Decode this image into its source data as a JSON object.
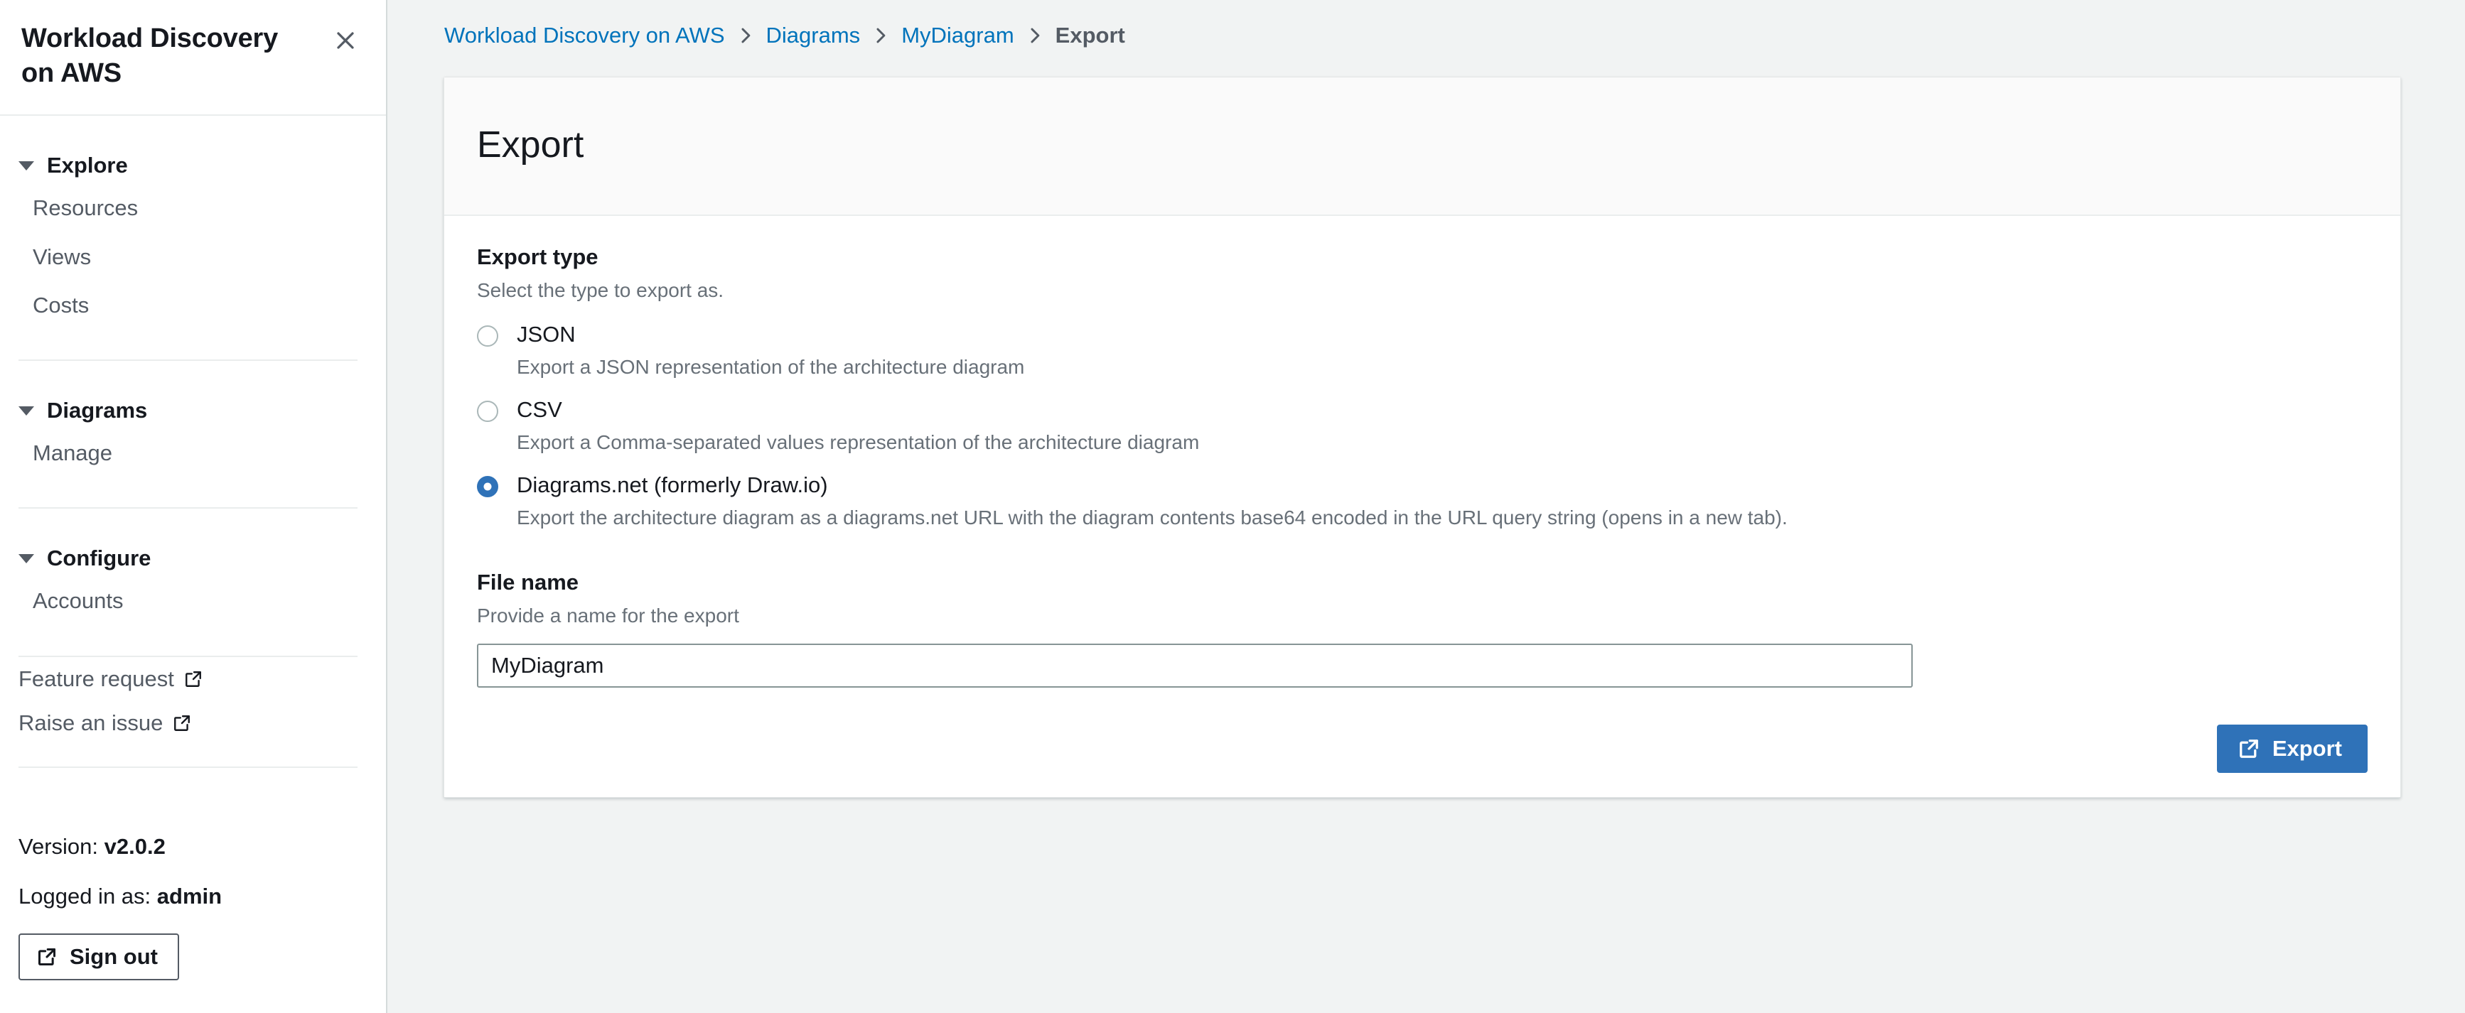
{
  "sidebar": {
    "title": "Workload Discovery on AWS",
    "close_icon": "close-icon",
    "groups": [
      {
        "label": "Explore",
        "items": [
          {
            "label": "Resources"
          },
          {
            "label": "Views"
          },
          {
            "label": "Costs"
          }
        ]
      },
      {
        "label": "Diagrams",
        "items": [
          {
            "label": "Manage"
          }
        ]
      },
      {
        "label": "Configure",
        "items": [
          {
            "label": "Accounts"
          }
        ]
      }
    ],
    "external_links": [
      {
        "label": "Feature request",
        "icon": "external-link-icon"
      },
      {
        "label": "Raise an issue",
        "icon": "external-link-icon"
      }
    ],
    "version_prefix": "Version:",
    "version_value": "v2.0.2",
    "logged_in_prefix": "Logged in as:",
    "logged_in_value": "admin",
    "signout_label": "Sign out",
    "signout_icon": "external-link-icon"
  },
  "breadcrumb": {
    "items": [
      {
        "label": "Workload Discovery on AWS",
        "current": false
      },
      {
        "label": "Diagrams",
        "current": false
      },
      {
        "label": "MyDiagram",
        "current": false
      },
      {
        "label": "Export",
        "current": true
      }
    ],
    "separator_icon": "chevron-right-icon"
  },
  "panel": {
    "title": "Export",
    "export_type": {
      "label": "Export type",
      "description": "Select the type to export as.",
      "options": [
        {
          "label": "JSON",
          "description": "Export a JSON representation of the architecture diagram",
          "selected": false
        },
        {
          "label": "CSV",
          "description": "Export a Comma-separated values representation of the architecture diagram",
          "selected": false
        },
        {
          "label": "Diagrams.net (formerly Draw.io)",
          "description": "Export the architecture diagram as a diagrams.net URL with the diagram contents base64 encoded in the URL query string (opens in a new tab).",
          "selected": true
        }
      ]
    },
    "file_name": {
      "label": "File name",
      "description": "Provide a name for the export",
      "value": "MyDiagram",
      "placeholder": ""
    },
    "export_button": {
      "label": "Export",
      "icon": "external-link-icon"
    }
  },
  "colors": {
    "accent_blue": "#2f72b8",
    "link_blue": "#0073bb",
    "text_dark": "#16191f",
    "text_muted": "#687078",
    "page_bg": "#f1f3f3",
    "panel_header_bg": "#fafafa",
    "border": "#eaeded"
  }
}
